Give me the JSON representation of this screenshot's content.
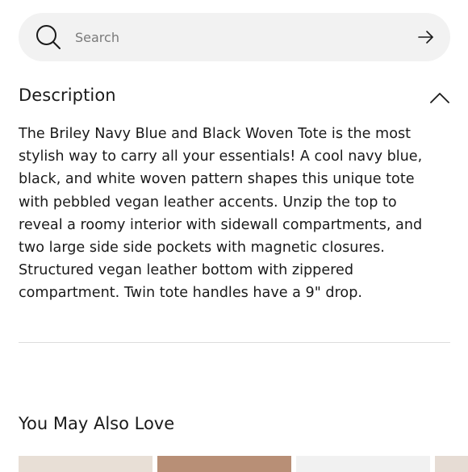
{
  "search": {
    "placeholder": "Search",
    "icon": "search-icon",
    "submit_icon": "arrow-right-icon"
  },
  "description": {
    "title": "Description",
    "toggle_icon": "chevron-up-icon",
    "text": "The Briley Navy Blue and Black Woven Tote is the most stylish way to carry all your essentials! A cool navy blue, black, and white woven pattern shapes this unique tote with pebbled vegan leather accents. Unzip the top to reveal a roomy interior with sidewall compartments, and two large side side pockets with magnetic closures. Structured vegan leather bottom with zippered compartment. Twin tote handles have a 9\" drop."
  },
  "recommendations": {
    "title": "You May Also Love",
    "thumb_colors": [
      "#e8dfd6",
      "#b88f76",
      "#f1f1f1",
      "#e6dcd4"
    ]
  },
  "colors": {
    "search_bg": "#f2f2f2",
    "text": "#1a1a1a",
    "placeholder": "#7a7a7a",
    "divider": "#dcdcdc"
  }
}
